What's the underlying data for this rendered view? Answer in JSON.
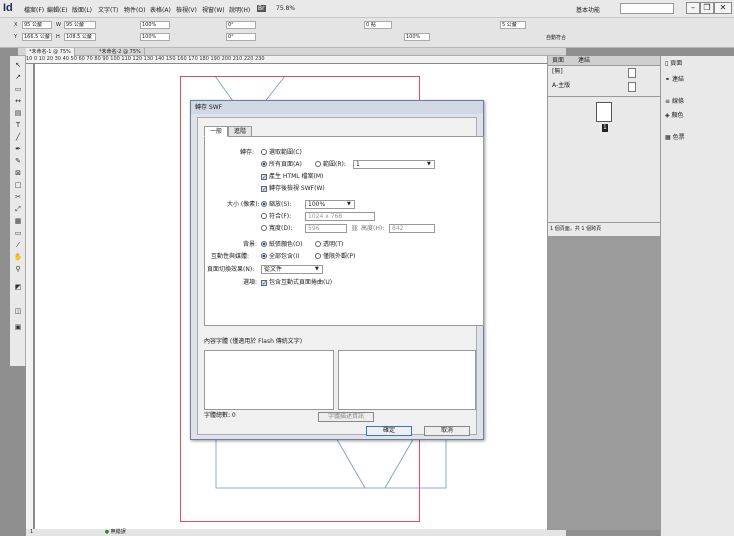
{
  "app": {
    "logo": "Id"
  },
  "menu": [
    "檔案(F)",
    "編輯(E)",
    "版面(L)",
    "文字(T)",
    "物件(O)",
    "表格(A)",
    "檢視(V)",
    "視窗(W)",
    "說明(H)",
    "Br",
    "75.8%",
    "",
    "",
    "",
    "基本功能"
  ],
  "window": {
    "minimize": "–",
    "restore": "❐",
    "close": "✕"
  },
  "control": {
    "x": "95 公釐",
    "y": "166.5 公釐",
    "w": "95 公釐",
    "h": "108.5 公釐",
    "scale_x": "100%",
    "scale_y": "100%",
    "rotate": "0°",
    "shear": "0°",
    "stroke": "0 點",
    "percent": "100%",
    "columns": "5 公釐",
    "autofit": "自動符合",
    "columns2": "5 公釐"
  },
  "doc_tabs": [
    "*未命名-1 @ 75%",
    "*未命名-2 @ 75%"
  ],
  "ruler_h": "10   0   10   20   30   40   50   60   70   80   90  100  110  120  130  140  150  160  170  180  190  200  210  220  230",
  "status": {
    "page": "1",
    "error": "無錯誤"
  },
  "pages_panel": {
    "tab1": "頁面",
    "tab2": "連結",
    "none": "[無]",
    "master": "A-主版",
    "count": "1 個頁面，共 1 個跨頁",
    "page_num": "1"
  },
  "dock": [
    "頁面",
    "連結",
    "線條",
    "顏色",
    "色票"
  ],
  "dialog": {
    "title": "轉存 SWF",
    "tabs": [
      "一般",
      "進階"
    ],
    "export_label": "轉存:",
    "selection": "選取範圍(C)",
    "all_pages": "所有頁面(A)",
    "range": "範圍(R):",
    "range_value": "1",
    "gen_html": "產生 HTML 檔案(M)",
    "view_swf": "轉存後檢視 SWF(W)",
    "size_label": "大小 (像素):",
    "scale": "縮放(S):",
    "scale_value": "100%",
    "fit": "符合(F):",
    "fit_value": "1024 x 768",
    "width": "寬度(D):",
    "width_value": "596",
    "height": "高度(H):",
    "height_value": "842",
    "background_label": "背景:",
    "paper_color": "紙張顏色(O)",
    "transparent": "透明(T)",
    "interactive_label": "互動性與媒體:",
    "include_all": "全部包含(I)",
    "appearance_only": "僅限外觀(P)",
    "transition_label": "頁面切換效果(N):",
    "transition_value": "從文件",
    "options_label": "選項:",
    "page_curl": "包含互動式頁面捲曲(U)",
    "description_label": "內容字體 (僅適用於 Flash 傳統文字)",
    "char_count": "字體總數: 0",
    "font_info_btn": "字體描述資訊",
    "ok": "確定",
    "cancel": "取消"
  }
}
